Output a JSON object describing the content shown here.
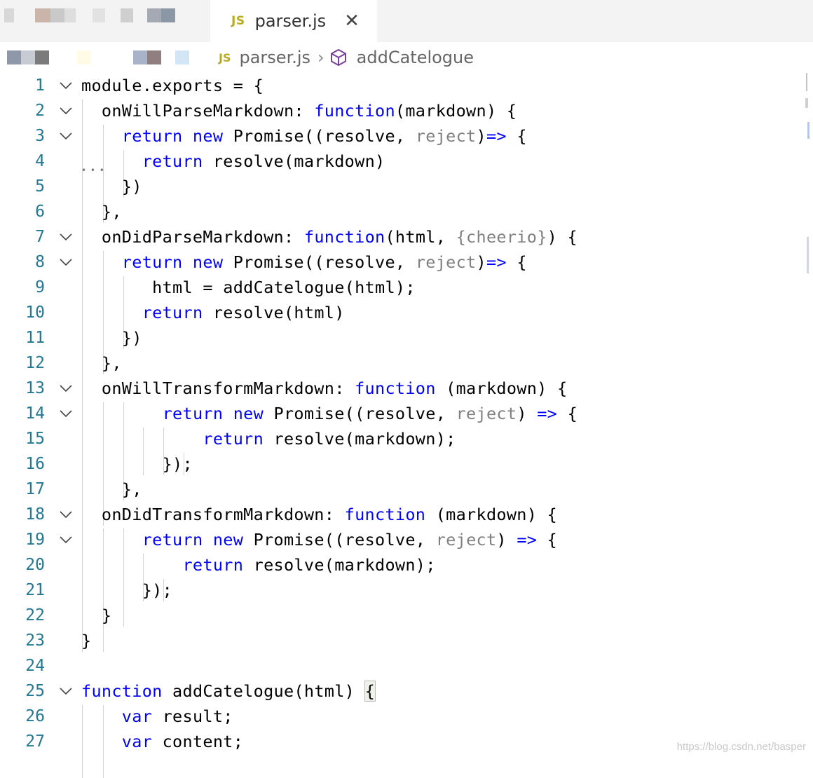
{
  "tab": {
    "badge": "JS",
    "title": "parser.js",
    "close": "✕"
  },
  "breadcrumb": {
    "badge": "JS",
    "file": "parser.js",
    "sep": "›",
    "symbol": "addCatelogue"
  },
  "lines": [
    {
      "n": "1",
      "fold": true,
      "tokens": [
        [
          "t",
          "module.exports = {"
        ]
      ]
    },
    {
      "n": "2",
      "fold": true,
      "tokens": [
        [
          "t",
          "  onWillParseMarkdown: "
        ],
        [
          "k",
          "function"
        ],
        [
          "t",
          "(markdown) {"
        ]
      ]
    },
    {
      "n": "3",
      "fold": true,
      "tokens": [
        [
          "t",
          "    "
        ],
        [
          "k",
          "return new "
        ],
        [
          "t",
          "Promise((resolve, "
        ],
        [
          "d",
          "reject"
        ],
        [
          "t",
          ")"
        ],
        [
          "k",
          "=>"
        ],
        [
          "t",
          " {"
        ]
      ]
    },
    {
      "n": "4",
      "fold": false,
      "tokens": [
        [
          "t",
          "      "
        ],
        [
          "k",
          "return "
        ],
        [
          "t",
          "resolve(markdown)"
        ]
      ]
    },
    {
      "n": "5",
      "fold": false,
      "tokens": [
        [
          "t",
          "    })"
        ]
      ]
    },
    {
      "n": "6",
      "fold": false,
      "tokens": [
        [
          "t",
          "  },"
        ]
      ]
    },
    {
      "n": "7",
      "fold": true,
      "tokens": [
        [
          "t",
          "  onDidParseMarkdown: "
        ],
        [
          "k",
          "function"
        ],
        [
          "t",
          "(html, "
        ],
        [
          "d",
          "{cheerio}"
        ],
        [
          "t",
          ") {"
        ]
      ]
    },
    {
      "n": "8",
      "fold": true,
      "tokens": [
        [
          "t",
          "    "
        ],
        [
          "k",
          "return new "
        ],
        [
          "t",
          "Promise((resolve, "
        ],
        [
          "d",
          "reject"
        ],
        [
          "t",
          ")"
        ],
        [
          "k",
          "=>"
        ],
        [
          "t",
          " {"
        ]
      ]
    },
    {
      "n": "9",
      "fold": false,
      "tokens": [
        [
          "t",
          "       html = addCatelogue(html);"
        ]
      ]
    },
    {
      "n": "10",
      "fold": false,
      "tokens": [
        [
          "t",
          "      "
        ],
        [
          "k",
          "return "
        ],
        [
          "t",
          "resolve(html)"
        ]
      ]
    },
    {
      "n": "11",
      "fold": false,
      "tokens": [
        [
          "t",
          "    })"
        ]
      ]
    },
    {
      "n": "12",
      "fold": false,
      "tokens": [
        [
          "t",
          "  },"
        ]
      ]
    },
    {
      "n": "13",
      "fold": true,
      "tokens": [
        [
          "t",
          "  onWillTransformMarkdown: "
        ],
        [
          "k",
          "function"
        ],
        [
          "t",
          " (markdown) {"
        ]
      ]
    },
    {
      "n": "14",
      "fold": true,
      "tokens": [
        [
          "t",
          "        "
        ],
        [
          "k",
          "return new "
        ],
        [
          "t",
          "Promise((resolve, "
        ],
        [
          "d",
          "reject"
        ],
        [
          "t",
          ") "
        ],
        [
          "k",
          "=>"
        ],
        [
          "t",
          " {"
        ]
      ]
    },
    {
      "n": "15",
      "fold": false,
      "tokens": [
        [
          "t",
          "            "
        ],
        [
          "k",
          "return "
        ],
        [
          "t",
          "resolve(markdown);"
        ]
      ]
    },
    {
      "n": "16",
      "fold": false,
      "tokens": [
        [
          "t",
          "        });"
        ]
      ]
    },
    {
      "n": "17",
      "fold": false,
      "tokens": [
        [
          "t",
          "    },"
        ]
      ]
    },
    {
      "n": "18",
      "fold": true,
      "tokens": [
        [
          "t",
          "  onDidTransformMarkdown: "
        ],
        [
          "k",
          "function"
        ],
        [
          "t",
          " (markdown) {"
        ]
      ]
    },
    {
      "n": "19",
      "fold": true,
      "tokens": [
        [
          "t",
          "      "
        ],
        [
          "k",
          "return new "
        ],
        [
          "t",
          "Promise((resolve, "
        ],
        [
          "d",
          "reject"
        ],
        [
          "t",
          ") "
        ],
        [
          "k",
          "=>"
        ],
        [
          "t",
          " {"
        ]
      ]
    },
    {
      "n": "20",
      "fold": false,
      "tokens": [
        [
          "t",
          "          "
        ],
        [
          "k",
          "return "
        ],
        [
          "t",
          "resolve(markdown);"
        ]
      ]
    },
    {
      "n": "21",
      "fold": false,
      "tokens": [
        [
          "t",
          "      });"
        ]
      ]
    },
    {
      "n": "22",
      "fold": false,
      "tokens": [
        [
          "t",
          "  }"
        ]
      ]
    },
    {
      "n": "23",
      "fold": false,
      "tokens": [
        [
          "t",
          "}"
        ]
      ]
    },
    {
      "n": "24",
      "fold": false,
      "tokens": []
    },
    {
      "n": "25",
      "fold": true,
      "tokens": [
        [
          "k",
          "function"
        ],
        [
          "t",
          " addCatelogue(html) "
        ],
        [
          "b",
          "{"
        ]
      ]
    },
    {
      "n": "26",
      "fold": false,
      "tokens": [
        [
          "t",
          "    "
        ],
        [
          "k",
          "var"
        ],
        [
          "t",
          " result;"
        ]
      ]
    },
    {
      "n": "27",
      "fold": false,
      "tokens": [
        [
          "t",
          "    "
        ],
        [
          "k",
          "var"
        ],
        [
          "t",
          " content;"
        ]
      ]
    }
  ],
  "watermark": "https://blog.csdn.net/basper",
  "colors": {
    "keyword": "#0000ff",
    "param_dim": "#808080",
    "line_number": "#237893",
    "js_badge": "#b9ab1e"
  }
}
